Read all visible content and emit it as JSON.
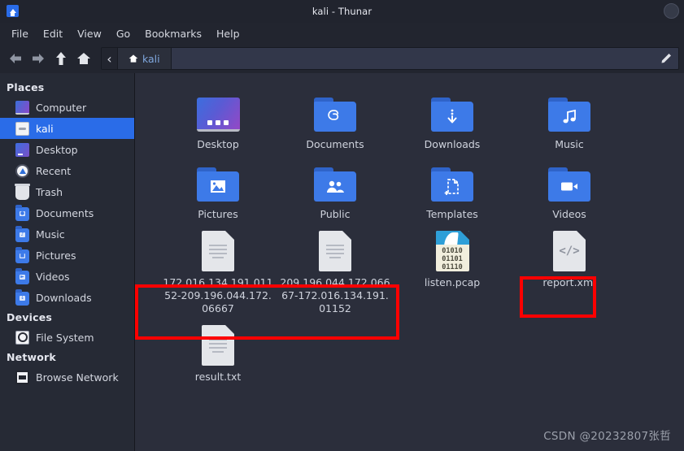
{
  "window": {
    "title": "kali - Thunar",
    "app_icon": "home-folder-icon",
    "close_button": "window-close-button"
  },
  "menubar": {
    "items": [
      {
        "label": "File"
      },
      {
        "label": "Edit"
      },
      {
        "label": "View"
      },
      {
        "label": "Go"
      },
      {
        "label": "Bookmarks"
      },
      {
        "label": "Help"
      }
    ]
  },
  "toolbar": {
    "back": "back-arrow-icon",
    "forward": "forward-arrow-icon",
    "up": "up-arrow-icon",
    "home": "home-icon",
    "edit_path": "pencil-icon",
    "path": {
      "previous_label": "‹",
      "current_label": "kali",
      "current_icon": "home-icon"
    }
  },
  "sidebar": {
    "sections": [
      {
        "heading": "Places",
        "items": [
          {
            "label": "Computer",
            "icon": "computer-icon",
            "selected": false
          },
          {
            "label": "kali",
            "icon": "drive-icon",
            "selected": true
          },
          {
            "label": "Desktop",
            "icon": "desktop-icon",
            "selected": false
          },
          {
            "label": "Recent",
            "icon": "recent-clock-icon",
            "selected": false
          },
          {
            "label": "Trash",
            "icon": "trash-icon",
            "selected": false
          },
          {
            "label": "Documents",
            "icon": "folder-documents-icon",
            "selected": false
          },
          {
            "label": "Music",
            "icon": "folder-music-icon",
            "selected": false
          },
          {
            "label": "Pictures",
            "icon": "folder-pictures-icon",
            "selected": false
          },
          {
            "label": "Videos",
            "icon": "folder-videos-icon",
            "selected": false
          },
          {
            "label": "Downloads",
            "icon": "folder-downloads-icon",
            "selected": false
          }
        ]
      },
      {
        "heading": "Devices",
        "items": [
          {
            "label": "File System",
            "icon": "harddisk-icon",
            "selected": false
          }
        ]
      },
      {
        "heading": "Network",
        "items": [
          {
            "label": "Browse Network",
            "icon": "network-icon",
            "selected": false
          }
        ]
      }
    ]
  },
  "files": [
    {
      "name": "Desktop",
      "type": "desktop-tile",
      "highlighted": false
    },
    {
      "name": "Documents",
      "type": "folder-paperclip",
      "highlighted": false
    },
    {
      "name": "Downloads",
      "type": "folder-download",
      "highlighted": false
    },
    {
      "name": "Music",
      "type": "folder-music",
      "highlighted": false
    },
    {
      "name": "Pictures",
      "type": "folder-image",
      "highlighted": false
    },
    {
      "name": "Public",
      "type": "folder-people",
      "highlighted": false
    },
    {
      "name": "Templates",
      "type": "folder-template",
      "highlighted": false
    },
    {
      "name": "Videos",
      "type": "folder-video",
      "highlighted": false
    },
    {
      "name": "172.016.134.191.01152-209.196.044.172.06667",
      "type": "document",
      "highlighted": true
    },
    {
      "name": "209.196.044.172.06667-172.016.134.191.01152",
      "type": "document",
      "highlighted": true
    },
    {
      "name": "listen.pcap",
      "type": "pcap",
      "highlighted": false
    },
    {
      "name": "report.xml",
      "type": "xml",
      "highlighted": true
    },
    {
      "name": "result.txt",
      "type": "document",
      "highlighted": false
    }
  ],
  "pcap_icon": {
    "line1": "01010",
    "line2": "01101",
    "line3": "01110"
  },
  "xml_icon": {
    "glyph": "</>"
  },
  "annotations": {
    "boxes": [
      {
        "name": "stream-filenames-highlight",
        "color": "#fe0000"
      },
      {
        "name": "report-xml-highlight",
        "color": "#fe0000"
      }
    ]
  },
  "watermark": {
    "text": "CSDN @20232807张哲"
  },
  "colors": {
    "window_bg": "#2b2e3b",
    "chrome_bg": "#22252f",
    "titlebar_bg": "#21242e",
    "sidebar_bg": "#262a35",
    "selection_blue": "#2a6ce8",
    "folder_blue": "#3d7ae8",
    "text": "#d4d7e0",
    "annotation_red": "#fe0000"
  }
}
